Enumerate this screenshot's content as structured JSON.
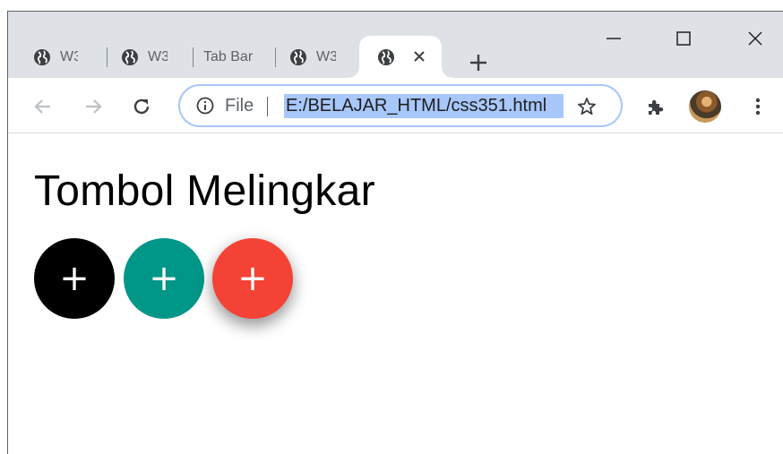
{
  "tabs": [
    {
      "title": "W3",
      "icon": "globe-icon"
    },
    {
      "title": "W3",
      "icon": "globe-icon"
    },
    {
      "title": "Tab Bar",
      "icon": ""
    },
    {
      "title": "W3",
      "icon": "globe-icon"
    },
    {
      "title": "",
      "icon": "globe-icon",
      "active": true
    }
  ],
  "toolbar": {
    "omnibox": {
      "scheme_label": "File",
      "url": "E:/BELAJAR_HTML/css351.html"
    }
  },
  "page": {
    "heading": "Tombol Melingkar",
    "buttons": [
      {
        "label": "+",
        "color": "#000000"
      },
      {
        "label": "+",
        "color": "#009688"
      },
      {
        "label": "+",
        "color": "#f44336"
      }
    ]
  },
  "colors": {
    "tabstrip_bg": "#dee1e6",
    "url_highlight": "#a8c7fa"
  }
}
